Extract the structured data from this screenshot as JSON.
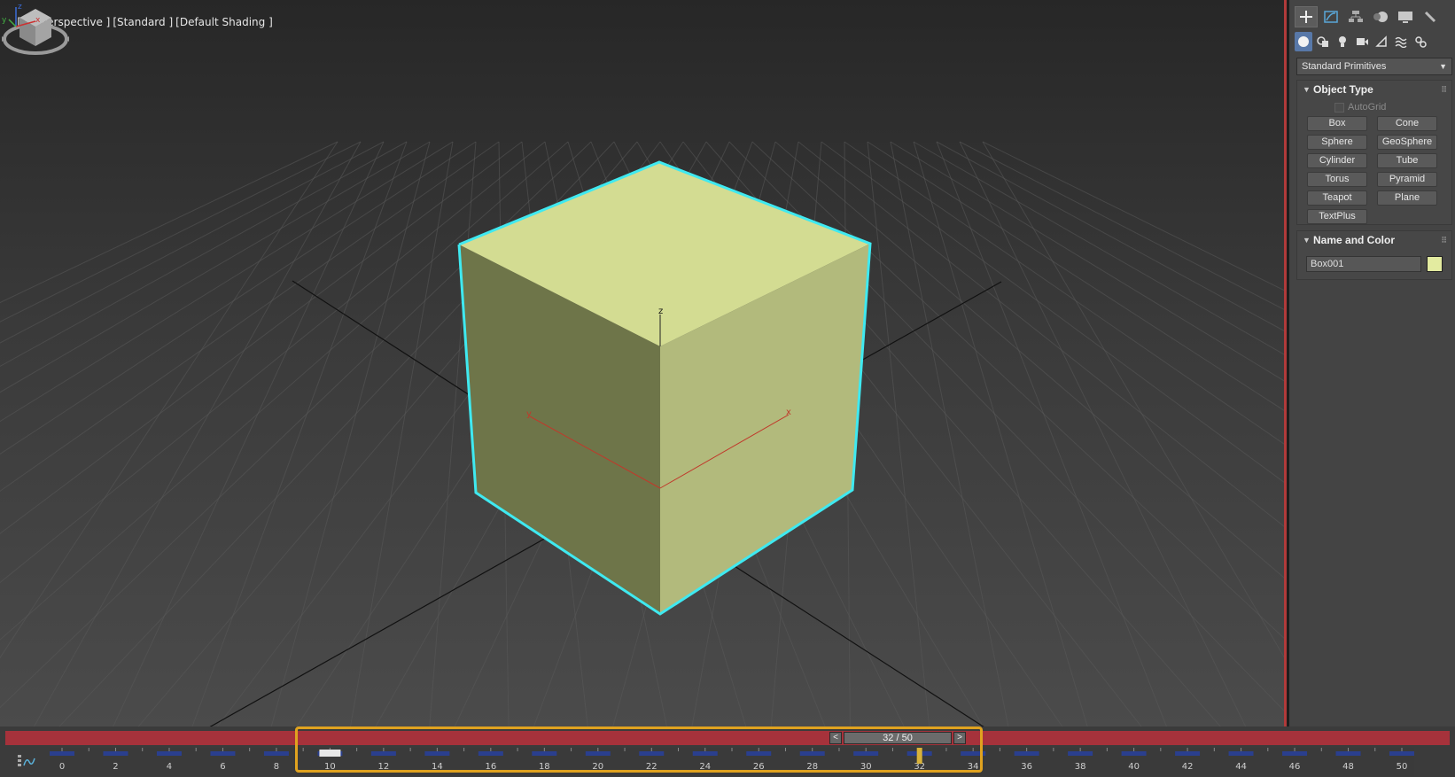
{
  "viewport": {
    "labels": [
      "[+]",
      "[Perspective ]",
      "[Standard ]",
      "[Default Shading ]"
    ],
    "axis_labels": {
      "x": "x",
      "y": "y",
      "z": "z"
    },
    "object_color": "#d3dc92",
    "selection_color": "#3fe9f0"
  },
  "command_panel": {
    "tabs": [
      {
        "icon": "create-icon"
      },
      {
        "icon": "modify-icon"
      },
      {
        "icon": "hierarchy-icon"
      },
      {
        "icon": "motion-icon"
      },
      {
        "icon": "display-icon"
      },
      {
        "icon": "utilities-icon"
      }
    ],
    "subcategories": [
      {
        "icon": "geometry-icon"
      },
      {
        "icon": "shapes-icon"
      },
      {
        "icon": "lights-icon"
      },
      {
        "icon": "cameras-icon"
      },
      {
        "icon": "helpers-icon"
      },
      {
        "icon": "spacewarps-icon"
      },
      {
        "icon": "systems-icon"
      }
    ],
    "category": "Standard Primitives",
    "object_type": {
      "title": "Object Type",
      "autogrid": "AutoGrid",
      "buttons": [
        "Box",
        "Cone",
        "Sphere",
        "GeoSphere",
        "Cylinder",
        "Tube",
        "Torus",
        "Pyramid",
        "Teapot",
        "Plane",
        "TextPlus"
      ]
    },
    "name_and_color": {
      "title": "Name and Color",
      "name": "Box001",
      "color": "#e3eba0"
    }
  },
  "timeline": {
    "current_frame": 32,
    "total_frames": 50,
    "frame_display": "32 / 50",
    "prev_label": "<",
    "next_label": ">",
    "ticks": [
      "0",
      "2",
      "4",
      "6",
      "8",
      "10",
      "12",
      "14",
      "16",
      "18",
      "20",
      "22",
      "24",
      "26",
      "28",
      "30",
      "32",
      "34",
      "36",
      "38",
      "40",
      "42",
      "44",
      "46",
      "48",
      "50"
    ]
  }
}
